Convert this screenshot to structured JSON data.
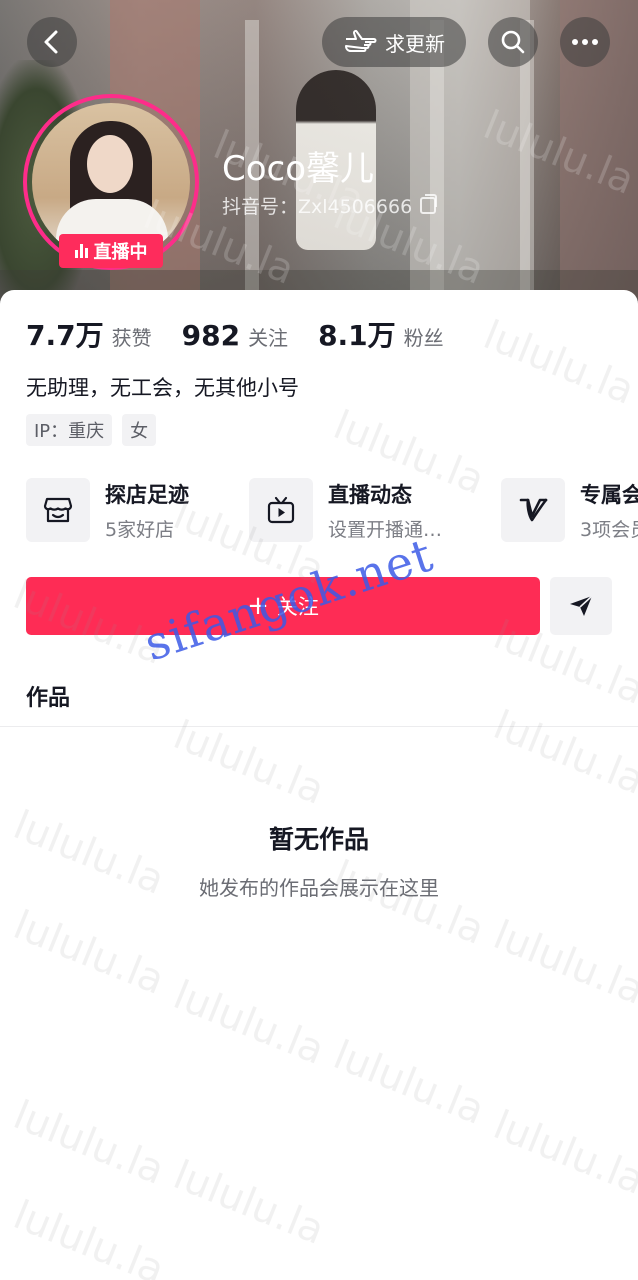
{
  "header": {
    "update_label": "求更新",
    "live_label": "直播中",
    "name": "Coco馨儿",
    "douyin_id": "抖音号：Zxl4506666"
  },
  "stats": [
    {
      "value": "7.7万",
      "label": "获赞"
    },
    {
      "value": "982",
      "label": "关注"
    },
    {
      "value": "8.1万",
      "label": "粉丝"
    }
  ],
  "bio": "无助理，无工会，无其他小号",
  "tags": [
    "IP：重庆",
    "女"
  ],
  "services": [
    {
      "title": "探店足迹",
      "subtitle": "5家好店",
      "icon": "shop-icon"
    },
    {
      "title": "直播动态",
      "subtitle": "设置开播通…",
      "icon": "tv-icon"
    },
    {
      "title": "专属会",
      "subtitle": "3项会员",
      "icon": "vip-icon"
    }
  ],
  "actions": {
    "follow_label": "关注",
    "send_icon": "send-icon"
  },
  "works_tab": "作品",
  "empty": {
    "title": "暂无作品",
    "subtitle": "她发布的作品会展示在这里"
  },
  "watermarks": {
    "repeat": "lululu.la",
    "site": "sifangok.net"
  },
  "colors": {
    "accent": "#fe2c55",
    "live": "#fe2c5c",
    "avatar_ring": "#fe2c8a",
    "site_watermark": "#3c5ae6"
  }
}
